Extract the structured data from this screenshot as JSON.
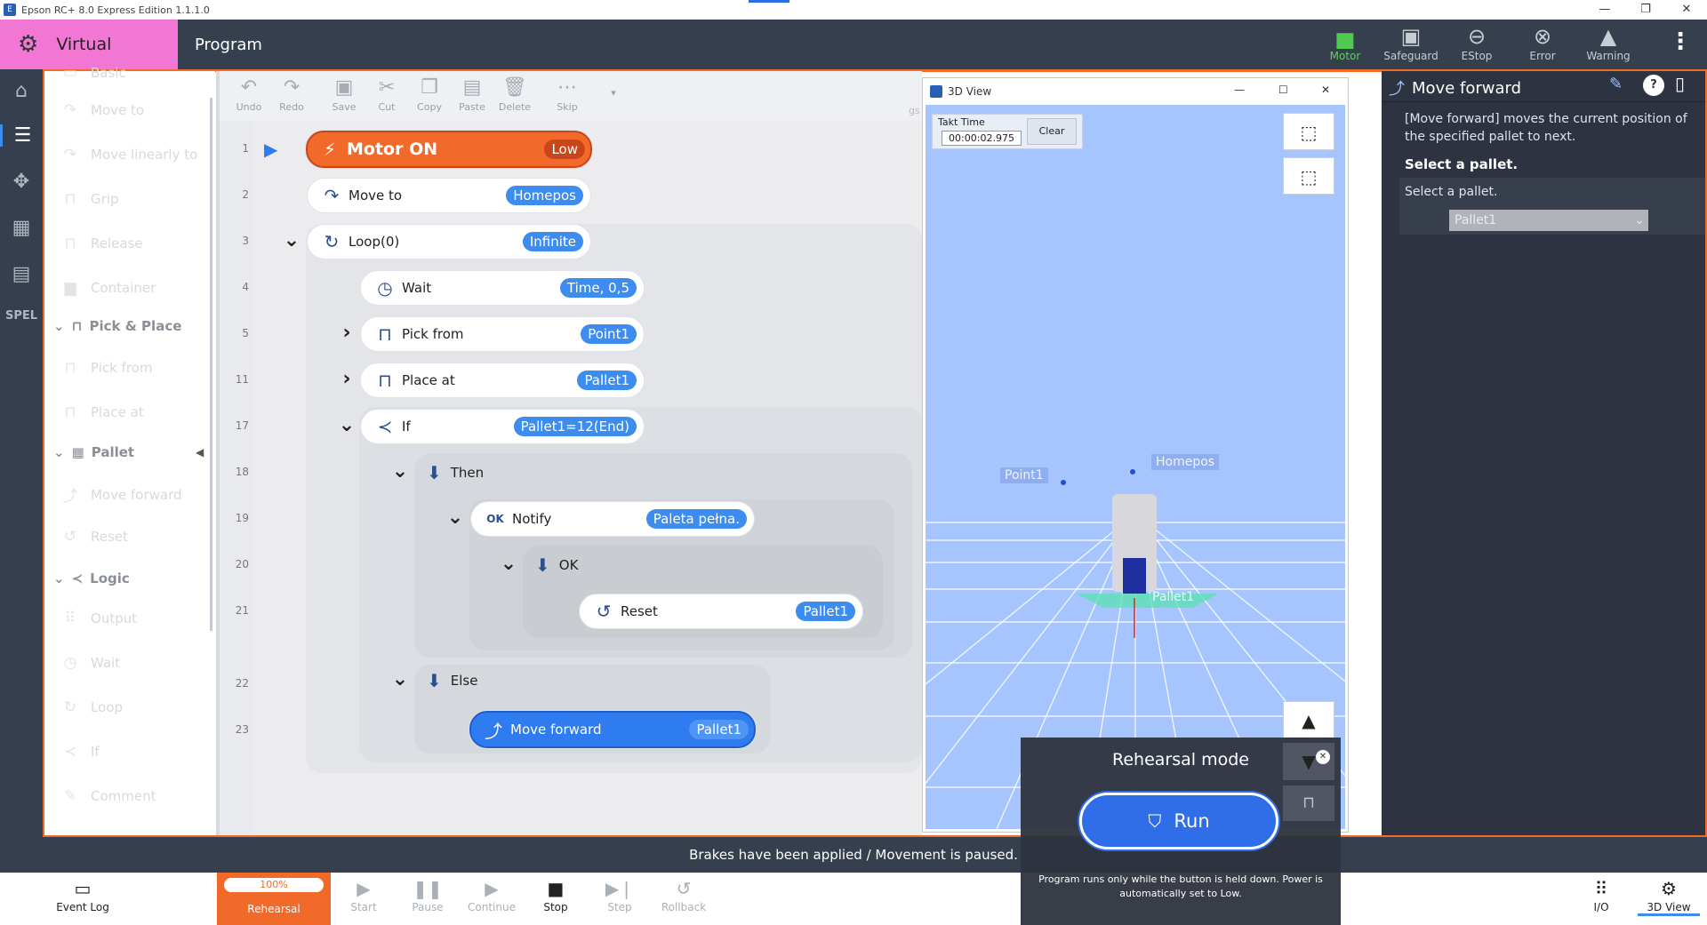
{
  "window": {
    "title": "Epson RC+ 8.0 Express Edition 1.1.1.0",
    "min": "—",
    "restore": "❐",
    "close": "✕"
  },
  "header": {
    "mode": "Virtual",
    "page": "Program",
    "status": [
      {
        "label": "Motor",
        "active": true
      },
      {
        "label": "Safeguard"
      },
      {
        "label": "EStop"
      },
      {
        "label": "Error"
      },
      {
        "label": "Warning"
      }
    ],
    "more": "⋮"
  },
  "palette": {
    "items": [
      {
        "label": "Basic"
      },
      {
        "label": "Move to"
      },
      {
        "label": "Move linearly to"
      },
      {
        "label": "Grip"
      },
      {
        "label": "Release"
      },
      {
        "label": "Container"
      },
      {
        "label": "Pick & Place",
        "header": true
      },
      {
        "label": "Pick from"
      },
      {
        "label": "Place at"
      },
      {
        "label": "Pallet",
        "header": true
      },
      {
        "label": "Move forward"
      },
      {
        "label": "Reset"
      },
      {
        "label": "Logic",
        "header": true
      },
      {
        "label": "Output"
      },
      {
        "label": "Wait"
      },
      {
        "label": "Loop"
      },
      {
        "label": "If"
      },
      {
        "label": "Comment"
      }
    ],
    "collapse": "◀"
  },
  "toolbar": {
    "undo": "Undo",
    "redo": "Redo",
    "save": "Save",
    "cut": "Cut",
    "copy": "Copy",
    "paste": "Paste",
    "delete": "Delete",
    "skip": "Skip",
    "more": "▾"
  },
  "program": {
    "lines": [
      "1",
      "2",
      "3",
      "4",
      "5",
      "11",
      "17",
      "18",
      "19",
      "20",
      "21",
      "22",
      "23"
    ],
    "blocks": [
      {
        "label": "Motor ON",
        "param": "Low"
      },
      {
        "label": "Move to",
        "param": "Homepos"
      },
      {
        "label": "Loop(0)",
        "param": "Infinite"
      },
      {
        "label": "Wait",
        "param": "Time, 0,5"
      },
      {
        "label": "Pick from",
        "param": "Point1"
      },
      {
        "label": "Place at",
        "param": "Pallet1"
      },
      {
        "label": "If",
        "param": "Pallet1=12(End)"
      },
      {
        "label": "Then"
      },
      {
        "label": "Notify",
        "param": "Paleta pełna."
      },
      {
        "label": "OK"
      },
      {
        "label": "Reset",
        "param": "Pallet1"
      },
      {
        "label": "Else"
      },
      {
        "label": "Move forward",
        "param": "Pallet1"
      }
    ],
    "behind": "gs"
  },
  "view3d": {
    "title": "3D View",
    "takt_label": "Takt Time",
    "takt_value": "00:00:02.975",
    "clear": "Clear",
    "tags": [
      "Point1",
      "Homepos",
      "Pallet1"
    ],
    "close": "✕",
    "restore": "☐",
    "min": "—"
  },
  "help": {
    "title": "Move forward",
    "desc": "[Move forward] moves the current position of the specified pallet to next.",
    "section": "Select a pallet.",
    "field_label": "Select a pallet.",
    "field_value": "Pallet1"
  },
  "status_bar": {
    "message": "Brakes have been applied / Movement is paused."
  },
  "bottom": {
    "event_log": "Event Log",
    "progress": "100%",
    "rehearsal": "Rehearsal",
    "start": "Start",
    "pause": "Pause",
    "continue": "Continue",
    "stop": "Stop",
    "step": "Step",
    "rollback": "Rollback",
    "io": "I/O",
    "view3d": "3D View",
    "expand": "»"
  },
  "rehearsal": {
    "title": "Rehearsal mode",
    "run": "Run",
    "note": "Program runs only while the button is held down. Power is automatically set to Low.",
    "close": "✕"
  },
  "help_icon": "?"
}
